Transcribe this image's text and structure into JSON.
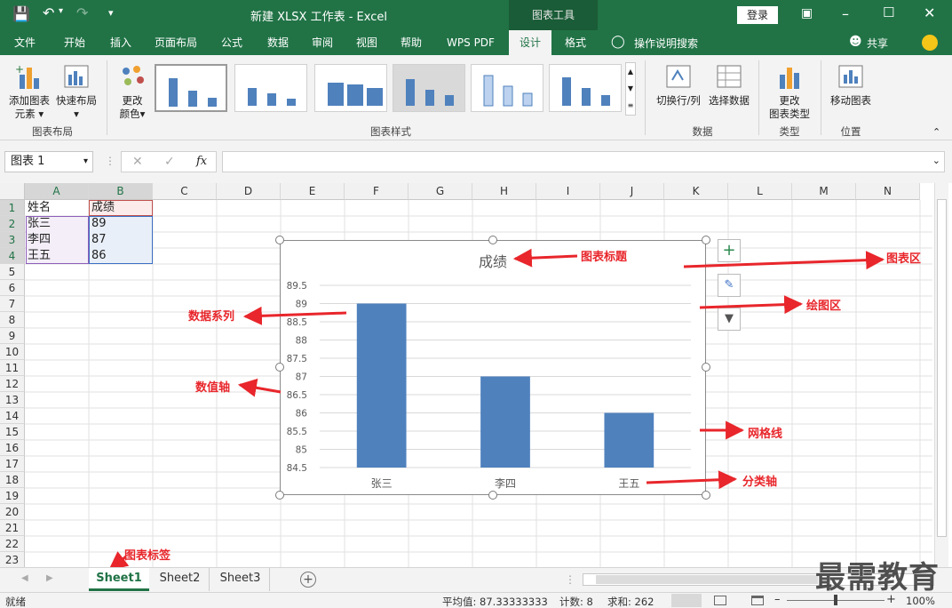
{
  "window": {
    "title": "新建 XLSX 工作表  -  Excel",
    "context_tab": "图表工具",
    "login_label": "登录"
  },
  "tabs": [
    "文件",
    "开始",
    "插入",
    "页面布局",
    "公式",
    "数据",
    "审阅",
    "视图",
    "帮助",
    "WPS PDF",
    "设计",
    "格式"
  ],
  "active_tab": "设计",
  "tellme": "操作说明搜索",
  "share": "共享",
  "ribbon": {
    "add_element": [
      "添加图表",
      "元素"
    ],
    "quick_layout": "快速布局",
    "change_color": [
      "更改",
      "颜色"
    ],
    "group_layout": "图表布局",
    "group_styles": "图表样式",
    "switch_row_col": "切换行/列",
    "select_data": "选择数据",
    "group_data": "数据",
    "change_type": [
      "更改",
      "图表类型"
    ],
    "group_type": "类型",
    "move_chart": "移动图表",
    "group_location": "位置"
  },
  "namebox": "图表 1",
  "fx": "fx",
  "columns": [
    "A",
    "B",
    "C",
    "D",
    "E",
    "F",
    "G",
    "H",
    "I",
    "J",
    "K",
    "L",
    "M",
    "N"
  ],
  "rows": [
    "1",
    "2",
    "3",
    "4",
    "5",
    "6",
    "7",
    "8",
    "9",
    "10",
    "11",
    "12",
    "13",
    "14",
    "15",
    "16",
    "17",
    "18",
    "19",
    "20",
    "21",
    "22",
    "23"
  ],
  "cells": {
    "A1": "姓名",
    "B1": "成绩",
    "A2": "张三",
    "B2": "89",
    "A3": "李四",
    "B3": "87",
    "A4": "王五",
    "B4": "86"
  },
  "chart_data": {
    "type": "bar",
    "title": "成绩",
    "categories": [
      "张三",
      "李四",
      "王五"
    ],
    "values": [
      89,
      87,
      86
    ],
    "ylim": [
      84.5,
      89.5
    ],
    "yticks": [
      "89.5",
      "89",
      "88.5",
      "88",
      "87.5",
      "87",
      "86.5",
      "86",
      "85.5",
      "85",
      "84.5"
    ],
    "grid": true,
    "color": "#4f81bd"
  },
  "annotations": {
    "chart_title": "图表标题",
    "chart_area": "图表区",
    "plot_area": "绘图区",
    "data_series": "数据系列",
    "value_axis": "数值轴",
    "gridlines": "网格线",
    "category_axis": "分类轴",
    "sheet_label": "图表标签"
  },
  "sheets": [
    "Sheet1",
    "Sheet2",
    "Sheet3"
  ],
  "watermark": "最需教育",
  "status": {
    "ready": "就绪",
    "average": "平均值: 87.33333333",
    "count": "计数: 8",
    "sum": "求和: 262",
    "zoom": "100%"
  },
  "colors": {
    "accent": "#217346",
    "annotation": "#e8262b"
  }
}
